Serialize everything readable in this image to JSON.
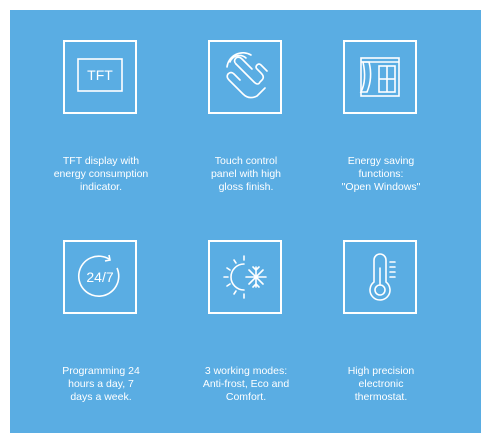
{
  "colors": {
    "background": "#5aade3",
    "foreground": "#ffffff"
  },
  "features": [
    {
      "icon": "tft-display-icon",
      "icon_text": "TFT",
      "caption": "TFT display with\nenergy consumption\nindicator."
    },
    {
      "icon": "touch-hand-icon",
      "caption": "Touch control\npanel with high\ngloss finish."
    },
    {
      "icon": "open-window-icon",
      "caption": "Energy saving\nfunctions:\n\"Open Windows\""
    },
    {
      "icon": "clock-24-7-icon",
      "icon_text": "24/7",
      "caption": "Programming 24\nhours a day, 7\ndays a week."
    },
    {
      "icon": "sun-snowflake-icon",
      "caption": "3 working modes:\nAnti-frost, Eco and\nComfort."
    },
    {
      "icon": "thermometer-icon",
      "caption": "High precision\nelectronic\nthermostat."
    }
  ]
}
